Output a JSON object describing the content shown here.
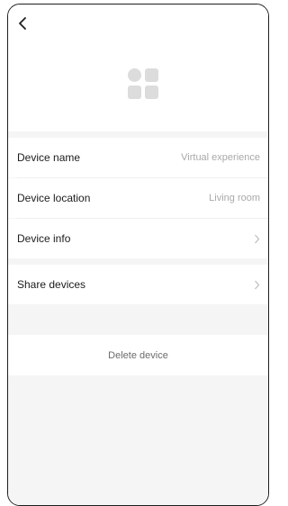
{
  "header": {
    "back_icon": "chevron-left-icon",
    "device_icon": "grid-four-squares-icon"
  },
  "rows": [
    {
      "label": "Device name",
      "value": "Virtual experience"
    },
    {
      "label": "Device location",
      "value": "Living room"
    },
    {
      "label": "Device info",
      "value": ""
    }
  ],
  "share": {
    "label": "Share devices"
  },
  "delete": {
    "label": "Delete device"
  },
  "colors": {
    "background": "#f5f5f5",
    "card": "#ffffff",
    "muted_text": "#a9a9a9",
    "icon_gray": "#dcdcdc"
  }
}
